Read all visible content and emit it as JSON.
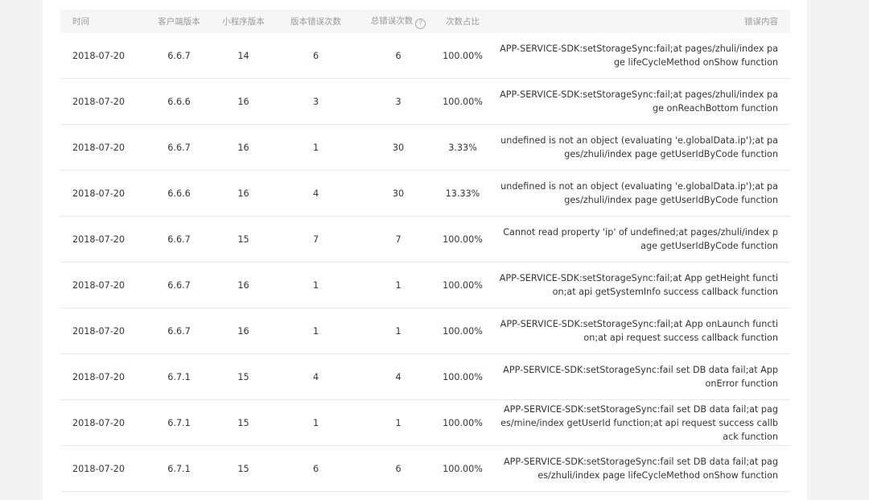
{
  "headers": {
    "time": "时间",
    "client_version": "客户端版本",
    "miniprogram_version": "小程序版本",
    "version_error_count": "版本错误次数",
    "total_error_count": "总错误次数",
    "help_glyph": "?",
    "ratio": "次数占比",
    "error_content": "错误内容"
  },
  "rows": [
    {
      "time": "2018-07-20",
      "client": "6.6.7",
      "mp": "14",
      "ver_errors": "6",
      "total_errors": "6",
      "ratio": "100.00%",
      "message": "APP-SERVICE-SDK:setStorageSync:fail;at pages/zhuli/index page lifeCycleMethod onShow function"
    },
    {
      "time": "2018-07-20",
      "client": "6.6.6",
      "mp": "16",
      "ver_errors": "3",
      "total_errors": "3",
      "ratio": "100.00%",
      "message": "APP-SERVICE-SDK:setStorageSync:fail;at pages/zhuli/index page onReachBottom function"
    },
    {
      "time": "2018-07-20",
      "client": "6.6.7",
      "mp": "16",
      "ver_errors": "1",
      "total_errors": "30",
      "ratio": "3.33%",
      "message": "undefined is not an object (evaluating 'e.globalData.ip');at pages/zhuli/index page getUserIdByCode function"
    },
    {
      "time": "2018-07-20",
      "client": "6.6.6",
      "mp": "16",
      "ver_errors": "4",
      "total_errors": "30",
      "ratio": "13.33%",
      "message": "undefined is not an object (evaluating 'e.globalData.ip');at pages/zhuli/index page getUserIdByCode function"
    },
    {
      "time": "2018-07-20",
      "client": "6.6.7",
      "mp": "15",
      "ver_errors": "7",
      "total_errors": "7",
      "ratio": "100.00%",
      "message": "Cannot read property 'ip' of undefined;at pages/zhuli/index page getUserIdByCode function"
    },
    {
      "time": "2018-07-20",
      "client": "6.6.7",
      "mp": "16",
      "ver_errors": "1",
      "total_errors": "1",
      "ratio": "100.00%",
      "message": "APP-SERVICE-SDK:setStorageSync:fail;at App getHeight function;at api getSystemInfo success callback function"
    },
    {
      "time": "2018-07-20",
      "client": "6.6.7",
      "mp": "16",
      "ver_errors": "1",
      "total_errors": "1",
      "ratio": "100.00%",
      "message": "APP-SERVICE-SDK:setStorageSync:fail;at App onLaunch function;at api request success callback function"
    },
    {
      "time": "2018-07-20",
      "client": "6.7.1",
      "mp": "15",
      "ver_errors": "4",
      "total_errors": "4",
      "ratio": "100.00%",
      "message": "APP-SERVICE-SDK:setStorageSync:fail set DB data fail;at App onError function"
    },
    {
      "time": "2018-07-20",
      "client": "6.7.1",
      "mp": "15",
      "ver_errors": "1",
      "total_errors": "1",
      "ratio": "100.00%",
      "message": "APP-SERVICE-SDK:setStorageSync:fail set DB data fail;at pages/mine/index getUserId function;at api request success callback function"
    },
    {
      "time": "2018-07-20",
      "client": "6.7.1",
      "mp": "15",
      "ver_errors": "6",
      "total_errors": "6",
      "ratio": "100.00%",
      "message": "APP-SERVICE-SDK:setStorageSync:fail set DB data fail;at pages/zhuli/index page lifeCycleMethod onShow function"
    }
  ]
}
